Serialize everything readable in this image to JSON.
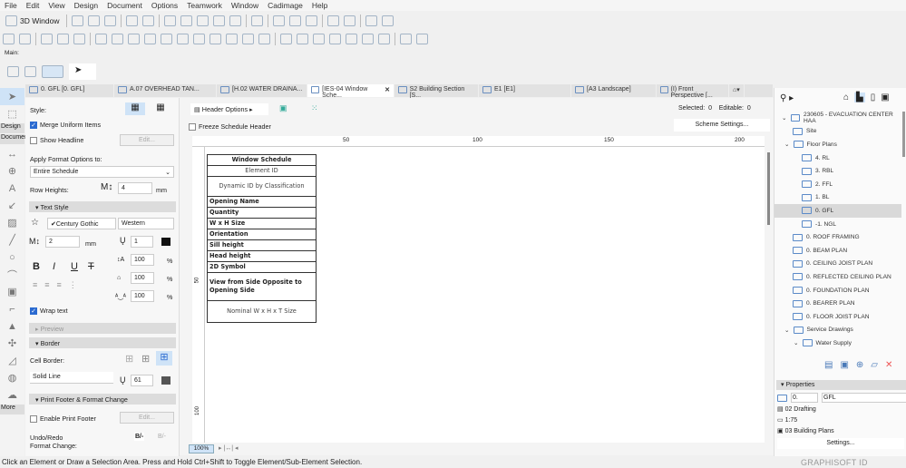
{
  "menu": [
    "File",
    "Edit",
    "View",
    "Design",
    "Document",
    "Options",
    "Teamwork",
    "Window",
    "Cadimage",
    "Help"
  ],
  "toolbar": {
    "window3d": "3D Window",
    "main_label": "Main:"
  },
  "tabs": [
    {
      "label": "0. GFL [0. GFL]",
      "active": false
    },
    {
      "label": "A.07 OVERHEAD TAN...",
      "active": false
    },
    {
      "label": "[H.02 WATER DRAINA...",
      "active": false
    },
    {
      "label": "[IES-04 Window Sche...",
      "active": true
    },
    {
      "label": "S2 Building Section [S...",
      "active": false
    },
    {
      "label": "E1 [E1]",
      "active": false
    },
    {
      "label": "[A3 Landscape]",
      "active": false
    },
    {
      "label": "(I) Front Perspective [...",
      "active": false
    }
  ],
  "toolbox": {
    "design": "Design",
    "document": "Documer",
    "more": "More"
  },
  "format": {
    "style_label": "Style:",
    "merge_uniform": "Merge Uniform Items",
    "merge_checked": true,
    "show_headline": "Show Headline",
    "show_checked": false,
    "edit1": "Edit...",
    "apply_label": "Apply Format Options to:",
    "apply_value": "Entire Schedule",
    "row_heights_label": "Row Heights:",
    "row_height": "4",
    "row_unit": "mm",
    "text_style": "Text Style",
    "font": "✔Century Gothic",
    "script": "Western",
    "text_size": "2",
    "text_unit": "mm",
    "pen": "1",
    "width_pct": "100",
    "spacing_pct": "100",
    "line_pct": "100",
    "pct": "%",
    "bold": "B",
    "italic": "I",
    "underline": "U",
    "strike": "T",
    "wrap_text": "Wrap text",
    "wrap_checked": true,
    "preview": "Preview",
    "border": "Border",
    "cell_border_label": "Cell Border:",
    "line_type": "Solid Line",
    "border_pen": "61",
    "print_footer": "Print Footer & Format Change",
    "enable_footer": "Enable Print Footer",
    "footer_checked": false,
    "edit2": "Edit...",
    "undo_label": "Undo/Redo\nFormat Change:",
    "undo_glyph": "B/-",
    "redo_glyph": "B/-"
  },
  "header": {
    "header_options": "Header Options",
    "selected_label": "Selected:",
    "selected": "0",
    "editable_label": "Editable:",
    "editable": "0",
    "freeze": "Freeze Schedule Header",
    "scheme": "Scheme Settings...",
    "ruler": [
      "50",
      "100",
      "150",
      "200"
    ],
    "vruler": [
      "50",
      "100"
    ]
  },
  "schedule": {
    "title": "Window Schedule",
    "element_id": "Element ID",
    "dynamic_id": "Dynamic ID by Classification",
    "rows": [
      "Opening Name",
      "Quantity",
      "W x H Size",
      "Orientation",
      "Sill height",
      "Head height",
      "2D Symbol"
    ],
    "view": "View from Side Opposite to Opening Side",
    "nominal": "Nominal W x H x T Size"
  },
  "zoom": "100%",
  "navigator": {
    "project": "230605 - EVACUATION CENTER HAA",
    "items": [
      {
        "label": "Site",
        "level": 1
      },
      {
        "label": "Floor Plans",
        "level": 1
      },
      {
        "label": "4. RL",
        "level": 2
      },
      {
        "label": "3. RBL",
        "level": 2
      },
      {
        "label": "2. FFL",
        "level": 2
      },
      {
        "label": "1. BL",
        "level": 2
      },
      {
        "label": "0. GFL",
        "level": 2,
        "selected": true
      },
      {
        "label": "-1. NGL",
        "level": 2
      },
      {
        "label": "0. ROOF FRAMING",
        "level": 1
      },
      {
        "label": "0. BEAM PLAN",
        "level": 1
      },
      {
        "label": "0. CEILING JOIST PLAN",
        "level": 1
      },
      {
        "label": "0. REFLECTED CEILING PLAN",
        "level": 1
      },
      {
        "label": "0. FOUNDATION PLAN",
        "level": 1
      },
      {
        "label": "0. BEARER PLAN",
        "level": 1
      },
      {
        "label": "0. FLOOR JOIST PLAN",
        "level": 1
      },
      {
        "label": "Service Drawings",
        "level": 1
      },
      {
        "label": "Water Supply",
        "level": 2
      }
    ],
    "properties": "Properties",
    "prop_id": "0.",
    "prop_name": "GFL",
    "layer": "02 Drafting",
    "scale": "1:75",
    "model": "03 Building Plans",
    "settings": "Settings...",
    "graphisoft": "GRAPHISOFT ID"
  },
  "status": "Click an Element or Draw a Selection Area. Press and Hold Ctrl+Shift to Toggle Element/Sub-Element Selection.",
  "colors": {
    "accent": "#2a6ad0",
    "selected": "#d9d9d9",
    "active_btn": "#cfe3f7"
  }
}
